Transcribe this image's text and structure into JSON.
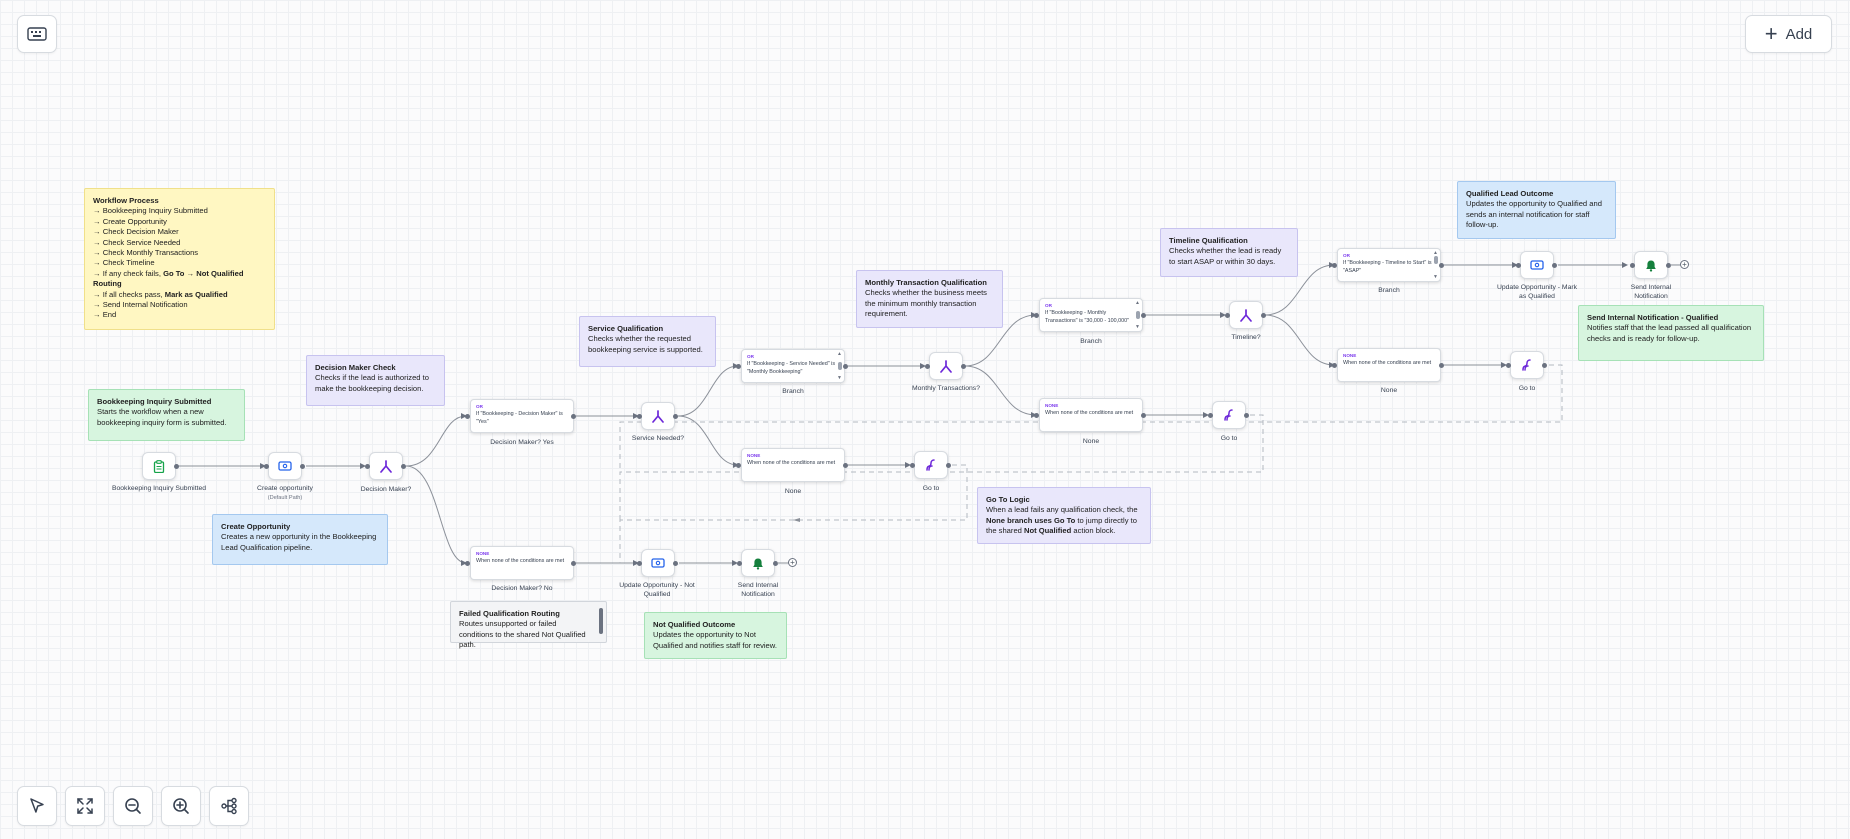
{
  "toolbar": {
    "add_label": "Add"
  },
  "nodes": {
    "trigger": "Bookkeeping Inquiry Submitted",
    "create_opp": "Create opportunity",
    "create_opp_sub": "(Default Path)",
    "decision_maker": "Decision Maker?",
    "dm_yes": "Decision Maker? Yes",
    "dm_no": "Decision Maker? No",
    "service_needed": "Service Needed?",
    "branch1": "Branch",
    "none1": "None",
    "goto1": "Go to",
    "monthly_tx": "Monthly Transactions?",
    "branch2": "Branch",
    "none2": "None",
    "goto2": "Go to",
    "timeline": "Timeline?",
    "branch3": "Branch",
    "none3": "None",
    "goto3": "Go to",
    "update_qualified": "Update Opportunity - Mark as Qualified",
    "send_notif_q": "Send Internal Notification",
    "update_not_qualified": "Update Opportunity - Not Qualified",
    "send_notif_nq": "Send Internal Notification"
  },
  "cards": {
    "dm_yes": {
      "tag": "OR",
      "text": "If \"Bookkeeping - Decision Maker\" is \"Yes\""
    },
    "dm_no": {
      "tag": "NONE",
      "text": "When none of the conditions are met"
    },
    "svc_branch": {
      "tag": "OR",
      "text": "If \"Bookkeeping - Service Needed\" is \"Monthly Bookkeeping\""
    },
    "svc_none": {
      "tag": "NONE",
      "text": "When none of the conditions are met"
    },
    "mt_branch": {
      "tag": "OR",
      "text": "If \"Bookkeeping - Monthly Transactions\" is \"30,000 - 100,000\""
    },
    "mt_none": {
      "tag": "NONE",
      "text": "When none of the conditions are met"
    },
    "tl_branch": {
      "tag": "OR",
      "text": "If \"Bookkeeping - Timeline to Start\" is \"ASAP\""
    },
    "tl_none": {
      "tag": "NONE",
      "text": "When none of the conditions are met"
    }
  },
  "notes": {
    "workflow": {
      "title": "Workflow Process",
      "lines": [
        "→ Bookkeeping Inquiry Submitted",
        "→ Create Opportunity",
        "→ Check Decision Maker",
        "→ Check Service Needed",
        "→ Check Monthly Transactions",
        "→ Check Timeline"
      ],
      "fail_prefix": "→ If any check fails, ",
      "fail_bold": "Go To → Not Qualified Routing",
      "pass_prefix": "→ If all checks pass, ",
      "pass_bold": "Mark as Qualified",
      "tail": [
        "→ Send Internal Notification",
        "→ End"
      ]
    },
    "inquiry": {
      "title": "Bookkeeping Inquiry Submitted",
      "body": "Starts the workflow when a new bookkeeping inquiry form is submitted."
    },
    "create": {
      "title": "Create Opportunity",
      "body": "Creates a new opportunity in the Bookkeeping Lead Qualification pipeline."
    },
    "dm_check": {
      "title": "Decision Maker Check",
      "body": "Checks if the lead is authorized to make the bookkeeping decision."
    },
    "service": {
      "title": "Service Qualification",
      "body": "Checks whether the requested bookkeeping service is supported."
    },
    "monthly": {
      "title": "Monthly Transaction Qualification",
      "body": "Checks whether the business meets the minimum monthly transaction requirement."
    },
    "timeline": {
      "title": "Timeline Qualification",
      "body": "Checks whether the lead is ready to start ASAP or within 30 days."
    },
    "qualified": {
      "title": "Qualified Lead Outcome",
      "body": "Updates the opportunity to Qualified and sends an internal notification for staff follow-up."
    },
    "send_q": {
      "title": "Send Internal Notification - Qualified",
      "body": "Notifies staff that the lead passed all qualification checks and is ready for follow-up."
    },
    "goto": {
      "title": "Go To Logic",
      "p1": "When a lead fails any qualification check, the ",
      "b1": "None branch uses Go To",
      "p2": " to jump directly to the shared ",
      "b2": "Not Qualified",
      "p3": " action block."
    },
    "failed": {
      "title": "Failed Qualification Routing",
      "body": "Routes unsupported or failed conditions to the shared Not Qualified path."
    },
    "not_qualified": {
      "title": "Not Qualified Outcome",
      "body": "Updates the opportunity to Not Qualified and notifies staff for review."
    }
  },
  "colors": {
    "accent": "#7c3aed",
    "action_blue": "#2563eb",
    "notify_green": "#15803d"
  },
  "icons": {
    "keyboard": "keyboard-icon",
    "pointer": "pointer-icon",
    "fit": "fit-view-icon",
    "zoom_out": "zoom-out-icon",
    "zoom_in": "zoom-in-icon",
    "layout": "auto-layout-icon"
  }
}
